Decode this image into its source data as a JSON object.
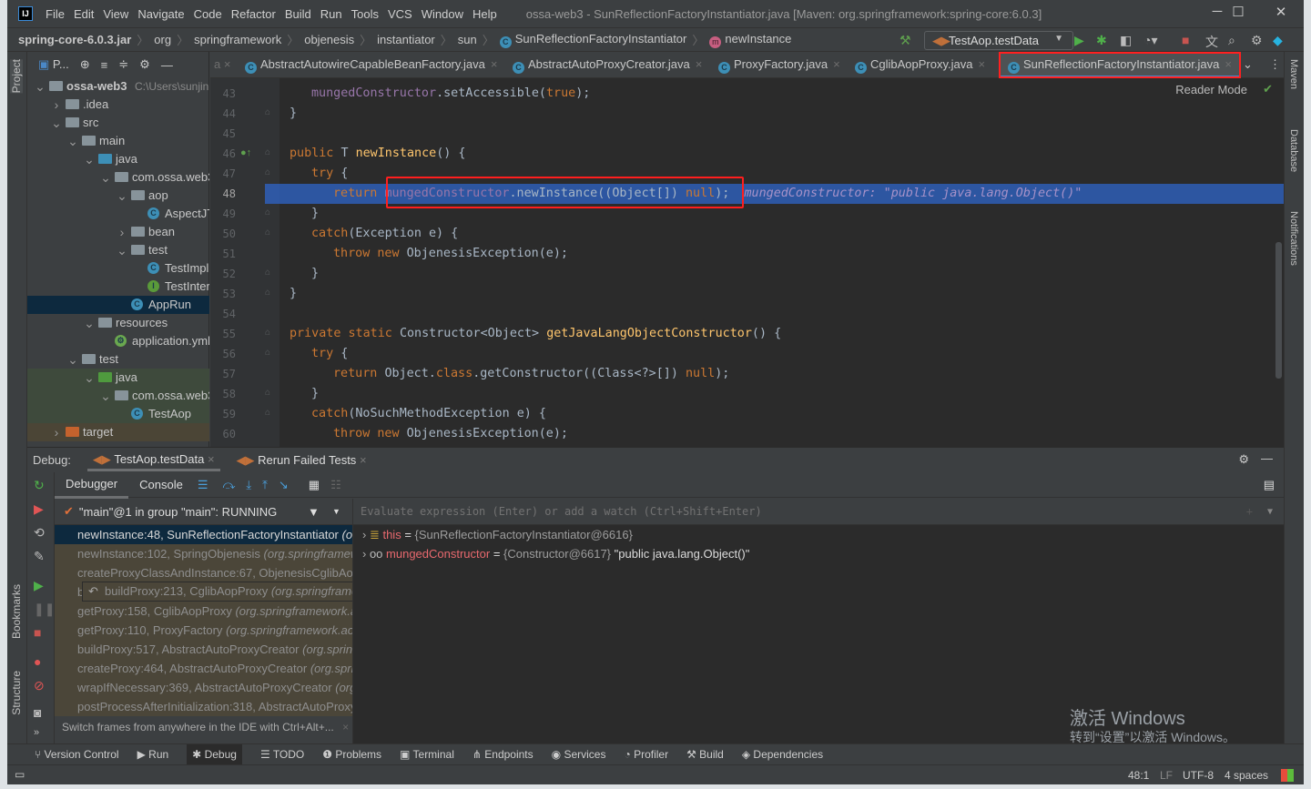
{
  "window": {
    "title": "ossa-web3 - SunReflectionFactoryInstantiator.java [Maven: org.springframework:spring-core:6.0.3]",
    "logo": "IJ",
    "controls": {
      "minimize": "─",
      "maximize": "☐",
      "close": "✕"
    }
  },
  "menu": [
    "File",
    "Edit",
    "View",
    "Navigate",
    "Code",
    "Refactor",
    "Build",
    "Run",
    "Tools",
    "VCS",
    "Window",
    "Help"
  ],
  "breadcrumb": [
    "spring-core-6.0.3.jar",
    "org",
    "springframework",
    "objenesis",
    "instantiator",
    "sun",
    "SunReflectionFactoryInstantiator",
    "newInstance"
  ],
  "run_config": "TestAop.testData",
  "left_stripe": {
    "project": "Project",
    "bookmarks": "Bookmarks",
    "structure": "Structure"
  },
  "right_stripe": {
    "maven": "Maven",
    "database": "Database",
    "notifications": "Notifications"
  },
  "project_panel": {
    "title": "P...",
    "items": [
      {
        "label": "ossa-web3",
        "extra": "C:\\Users\\sunjin",
        "depth": 0,
        "arrow": "down",
        "icon": "module-folder"
      },
      {
        "label": ".idea",
        "depth": 1,
        "arrow": "right",
        "icon": "folder"
      },
      {
        "label": "src",
        "depth": 1,
        "arrow": "down",
        "icon": "folder"
      },
      {
        "label": "main",
        "depth": 2,
        "arrow": "down",
        "icon": "folder"
      },
      {
        "label": "java",
        "depth": 3,
        "arrow": "down",
        "icon": "source-folder"
      },
      {
        "label": "com.ossa.web3",
        "depth": 4,
        "arrow": "down",
        "icon": "package"
      },
      {
        "label": "aop",
        "depth": 5,
        "arrow": "down",
        "icon": "package"
      },
      {
        "label": "AspectJTest",
        "depth": 6,
        "icon": "class"
      },
      {
        "label": "bean",
        "depth": 5,
        "arrow": "right",
        "icon": "package"
      },
      {
        "label": "test",
        "depth": 5,
        "arrow": "down",
        "icon": "package"
      },
      {
        "label": "TestImpl",
        "depth": 6,
        "icon": "class"
      },
      {
        "label": "TestInterface",
        "depth": 6,
        "icon": "interface"
      },
      {
        "label": "AppRun",
        "depth": 5,
        "icon": "spring-boot-class",
        "selected": true
      },
      {
        "label": "resources",
        "depth": 3,
        "arrow": "down",
        "icon": "resources-folder"
      },
      {
        "label": "application.yml",
        "depth": 4,
        "icon": "spring-config"
      },
      {
        "label": "test",
        "depth": 2,
        "arrow": "down",
        "icon": "folder"
      },
      {
        "label": "java",
        "depth": 3,
        "arrow": "down",
        "icon": "test-folder",
        "bg": "test"
      },
      {
        "label": "com.ossa.web3",
        "depth": 4,
        "arrow": "down",
        "icon": "package",
        "bg": "test"
      },
      {
        "label": "TestAop",
        "depth": 5,
        "icon": "test-class",
        "bg": "test"
      },
      {
        "label": "target",
        "depth": 1,
        "arrow": "right",
        "icon": "excluded-folder",
        "bg": "target"
      }
    ]
  },
  "editor": {
    "tabs": [
      {
        "label": "AbstractAutowireCapableBeanFactory.java"
      },
      {
        "label": "AbstractAutoProxyCreator.java"
      },
      {
        "label": "ProxyFactory.java"
      },
      {
        "label": "CglibAopProxy.java"
      },
      {
        "label": "SunReflectionFactoryInstantiator.java",
        "active": true
      }
    ],
    "reader_mode": "Reader Mode",
    "current_line": 48,
    "lines": [
      {
        "n": 43,
        "indent": 2,
        "tokens": [
          [
            "mungedConstructor",
            "f"
          ],
          [
            ".setAccessible(",
            "t"
          ],
          [
            "true",
            "k"
          ],
          [
            ");",
            "t"
          ]
        ]
      },
      {
        "n": 44,
        "indent": 1,
        "tokens": [
          [
            "}",
            "t"
          ]
        ]
      },
      {
        "n": 45,
        "indent": 0,
        "tokens": []
      },
      {
        "n": 46,
        "indent": 1,
        "tokens": [
          [
            "public ",
            "k"
          ],
          [
            "T ",
            "t"
          ],
          [
            "newInstance",
            "m"
          ],
          [
            "() {",
            "t"
          ]
        ]
      },
      {
        "n": 47,
        "indent": 2,
        "tokens": [
          [
            "try ",
            "k"
          ],
          [
            "{",
            "t"
          ]
        ]
      },
      {
        "n": 48,
        "indent": 3,
        "tokens": [
          [
            "return ",
            "k"
          ],
          [
            "mungedConstructor",
            "f"
          ],
          [
            ".newInstance((Object[]) ",
            "t"
          ],
          [
            "null",
            "k"
          ],
          [
            ");",
            "t"
          ],
          [
            "  mungedConstructor: \"public java.lang.Object()\"",
            "h"
          ]
        ]
      },
      {
        "n": 49,
        "indent": 2,
        "tokens": [
          [
            "}",
            "t"
          ]
        ]
      },
      {
        "n": 50,
        "indent": 2,
        "tokens": [
          [
            "catch",
            "k"
          ],
          [
            "(Exception e) {",
            "t"
          ]
        ]
      },
      {
        "n": 51,
        "indent": 3,
        "tokens": [
          [
            "throw new ",
            "k"
          ],
          [
            "ObjenesisException(e);",
            "t"
          ]
        ]
      },
      {
        "n": 52,
        "indent": 2,
        "tokens": [
          [
            "}",
            "t"
          ]
        ]
      },
      {
        "n": 53,
        "indent": 1,
        "tokens": [
          [
            "}",
            "t"
          ]
        ]
      },
      {
        "n": 54,
        "indent": 0,
        "tokens": []
      },
      {
        "n": 55,
        "indent": 1,
        "tokens": [
          [
            "private static ",
            "k"
          ],
          [
            "Constructor<Object> ",
            "t"
          ],
          [
            "getJavaLangObjectConstructor",
            "m"
          ],
          [
            "() {",
            "t"
          ]
        ]
      },
      {
        "n": 56,
        "indent": 2,
        "tokens": [
          [
            "try ",
            "k"
          ],
          [
            "{",
            "t"
          ]
        ]
      },
      {
        "n": 57,
        "indent": 3,
        "tokens": [
          [
            "return ",
            "k"
          ],
          [
            "Object.",
            "t"
          ],
          [
            "class",
            "k"
          ],
          [
            ".getConstructor((Class<?>[]) ",
            "t"
          ],
          [
            "null",
            "k"
          ],
          [
            ");",
            "t"
          ]
        ]
      },
      {
        "n": 58,
        "indent": 2,
        "tokens": [
          [
            "}",
            "t"
          ]
        ]
      },
      {
        "n": 59,
        "indent": 2,
        "tokens": [
          [
            "catch",
            "k"
          ],
          [
            "(NoSuchMethodException e) {",
            "t"
          ]
        ]
      },
      {
        "n": 60,
        "indent": 3,
        "tokens": [
          [
            "throw new ",
            "k"
          ],
          [
            "ObjenesisException(e);",
            "t"
          ]
        ]
      }
    ]
  },
  "debug": {
    "label": "Debug:",
    "tabs": [
      "TestAop.testData",
      "Rerun Failed Tests"
    ],
    "subtabs": {
      "debugger": "Debugger",
      "console": "Console"
    },
    "thread": "\"main\"@1 in group \"main\": RUNNING",
    "frames": [
      {
        "method": "newInstance:48, SunReflectionFactoryInstantiator",
        "pkg": "(org.springframework.objenesis.instantiator.sun)",
        "selected": true
      },
      {
        "method": "newInstance:102, SpringObjenesis",
        "pkg": "(org.springframework.objenesis)"
      },
      {
        "method": "createProxyClassAndInstance:67, ObjenesisCglibAopProxy",
        "pkg": "(org.springframework.aop.framework)"
      },
      {
        "method": "buildProxy:213, CglibAopProxy",
        "pkg": "(org.springframework.aop.framework)",
        "hover": true
      },
      {
        "method": "getProxy:158, CglibAopProxy",
        "pkg": "(org.springframework.aop.framework)"
      },
      {
        "method": "getProxy:110, ProxyFactory",
        "pkg": "(org.springframework.aop.framework)"
      },
      {
        "method": "buildProxy:517, AbstractAutoProxyCreator",
        "pkg": "(org.springframework.aop.framework.autoproxy)"
      },
      {
        "method": "createProxy:464, AbstractAutoProxyCreator",
        "pkg": "(org.springframework.aop.framework.autoproxy)"
      },
      {
        "method": "wrapIfNecessary:369, AbstractAutoProxyCreator",
        "pkg": "(org.springframework.aop.framework.autoproxy)"
      },
      {
        "method": "postProcessAfterInitialization:318, AbstractAutoProxyCreator",
        "pkg": "(org.springframework.aop.framework.autoproxy)"
      }
    ],
    "tip": "Switch frames from anywhere in the IDE with Ctrl+Alt+...",
    "eval_placeholder": "Evaluate expression (Enter) or add a watch (Ctrl+Shift+Enter)",
    "variables": [
      {
        "name": "this",
        "value": "{SunReflectionFactoryInstantiator@6616}",
        "extra": ""
      },
      {
        "name": "mungedConstructor",
        "value": "{Constructor@6617}",
        "extra": "\"public java.lang.Object()\""
      }
    ]
  },
  "watermark": {
    "line1": "激活 Windows",
    "line2": "转到“设置”以激活 Windows。"
  },
  "bottom_tools": [
    "Version Control",
    "Run",
    "Debug",
    "TODO",
    "Problems",
    "Terminal",
    "Endpoints",
    "Services",
    "Profiler",
    "Build",
    "Dependencies"
  ],
  "bottom_active": "Debug",
  "status": {
    "position": "48:1",
    "line_sep": "LF",
    "encoding": "UTF-8",
    "indent": "4 spaces"
  },
  "colors": {
    "accent": "#4a88c7",
    "highlight_box": "#ff1e1e",
    "current_line": "#2f65ca",
    "keyword": "#cc7832",
    "field": "#9876aa",
    "method": "#ffc66d"
  }
}
